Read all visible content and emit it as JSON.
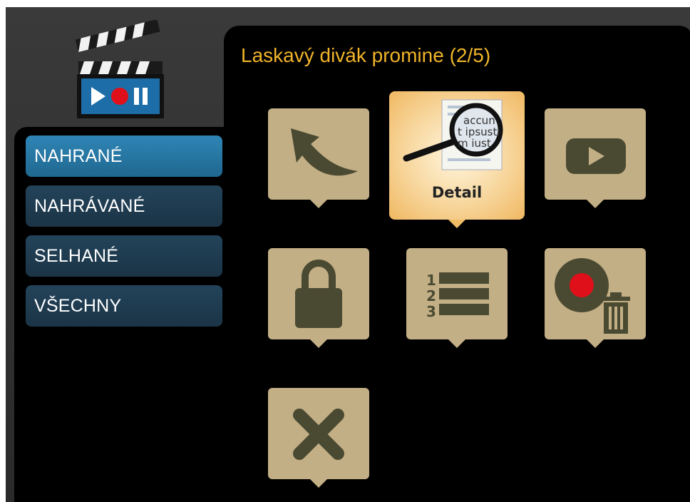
{
  "header": {
    "title": "Laskavý divák promine (2/5)"
  },
  "sidebar": {
    "items": [
      {
        "label": "NAHRANÉ",
        "active": true
      },
      {
        "label": "NAHRÁVANÉ",
        "active": false
      },
      {
        "label": "SELHANÉ",
        "active": false
      },
      {
        "label": "VŠECHNY",
        "active": false
      }
    ]
  },
  "actions": {
    "detail_label": "Detail",
    "tiles": [
      {
        "icon": "back-arrow-icon"
      },
      {
        "icon": "detail-magnifier-icon",
        "focused": true
      },
      {
        "icon": "play-icon"
      },
      {
        "icon": "lock-icon"
      },
      {
        "icon": "numbered-list-icon"
      },
      {
        "icon": "delete-recording-icon"
      },
      {
        "icon": "close-icon"
      }
    ],
    "detail_thumbnail_text": [
      "accun",
      "t ipsusti",
      "m iust"
    ],
    "list_numbers": [
      "1",
      "2",
      "3"
    ]
  },
  "colors": {
    "accent_title": "#f0b429",
    "active_item": "#2a7fb0",
    "menu_item": "#1f3b50",
    "tile": "#c3af85",
    "icon": "#4a4a32",
    "record_red": "#e0101a"
  }
}
